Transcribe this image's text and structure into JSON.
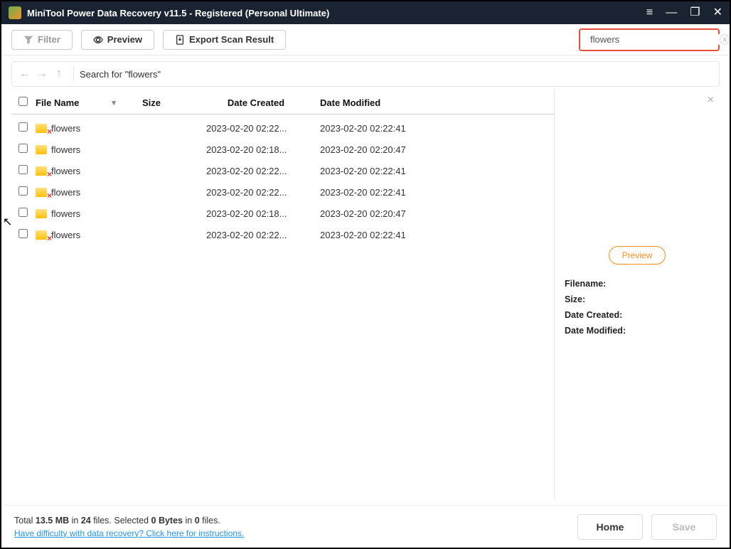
{
  "titlebar": {
    "title": "MiniTool Power Data Recovery v11.5 - Registered (Personal Ultimate)"
  },
  "toolbar": {
    "filter_label": "Filter",
    "preview_label": "Preview",
    "export_label": "Export Scan Result"
  },
  "search": {
    "value": "flowers"
  },
  "nav": {
    "path": "Search for  \"flowers\""
  },
  "columns": {
    "name": "File Name",
    "size": "Size",
    "created": "Date Created",
    "modified": "Date Modified"
  },
  "rows": [
    {
      "name": "flowers",
      "deleted": true,
      "created": "2023-02-20 02:22...",
      "modified": "2023-02-20 02:22:41"
    },
    {
      "name": "flowers",
      "deleted": false,
      "created": "2023-02-20 02:18...",
      "modified": "2023-02-20 02:20:47"
    },
    {
      "name": "flowers",
      "deleted": true,
      "created": "2023-02-20 02:22...",
      "modified": "2023-02-20 02:22:41"
    },
    {
      "name": "flowers",
      "deleted": true,
      "created": "2023-02-20 02:22...",
      "modified": "2023-02-20 02:22:41"
    },
    {
      "name": "flowers",
      "deleted": false,
      "created": "2023-02-20 02:18...",
      "modified": "2023-02-20 02:20:47"
    },
    {
      "name": "flowers",
      "deleted": true,
      "created": "2023-02-20 02:22...",
      "modified": "2023-02-20 02:22:41"
    }
  ],
  "preview": {
    "button_label": "Preview",
    "filename_label": "Filename:",
    "size_label": "Size:",
    "created_label": "Date Created:",
    "modified_label": "Date Modified:"
  },
  "footer": {
    "total_prefix": "Total ",
    "total_size": "13.5 MB",
    "in_label": " in ",
    "total_files": "24",
    "files_label": " files.",
    "selected_prefix": "  Selected ",
    "selected_size": "0 Bytes",
    "selected_files": "0",
    "help_link": "Have difficulty with data recovery? Click here for instructions.",
    "home_label": "Home",
    "save_label": "Save"
  }
}
